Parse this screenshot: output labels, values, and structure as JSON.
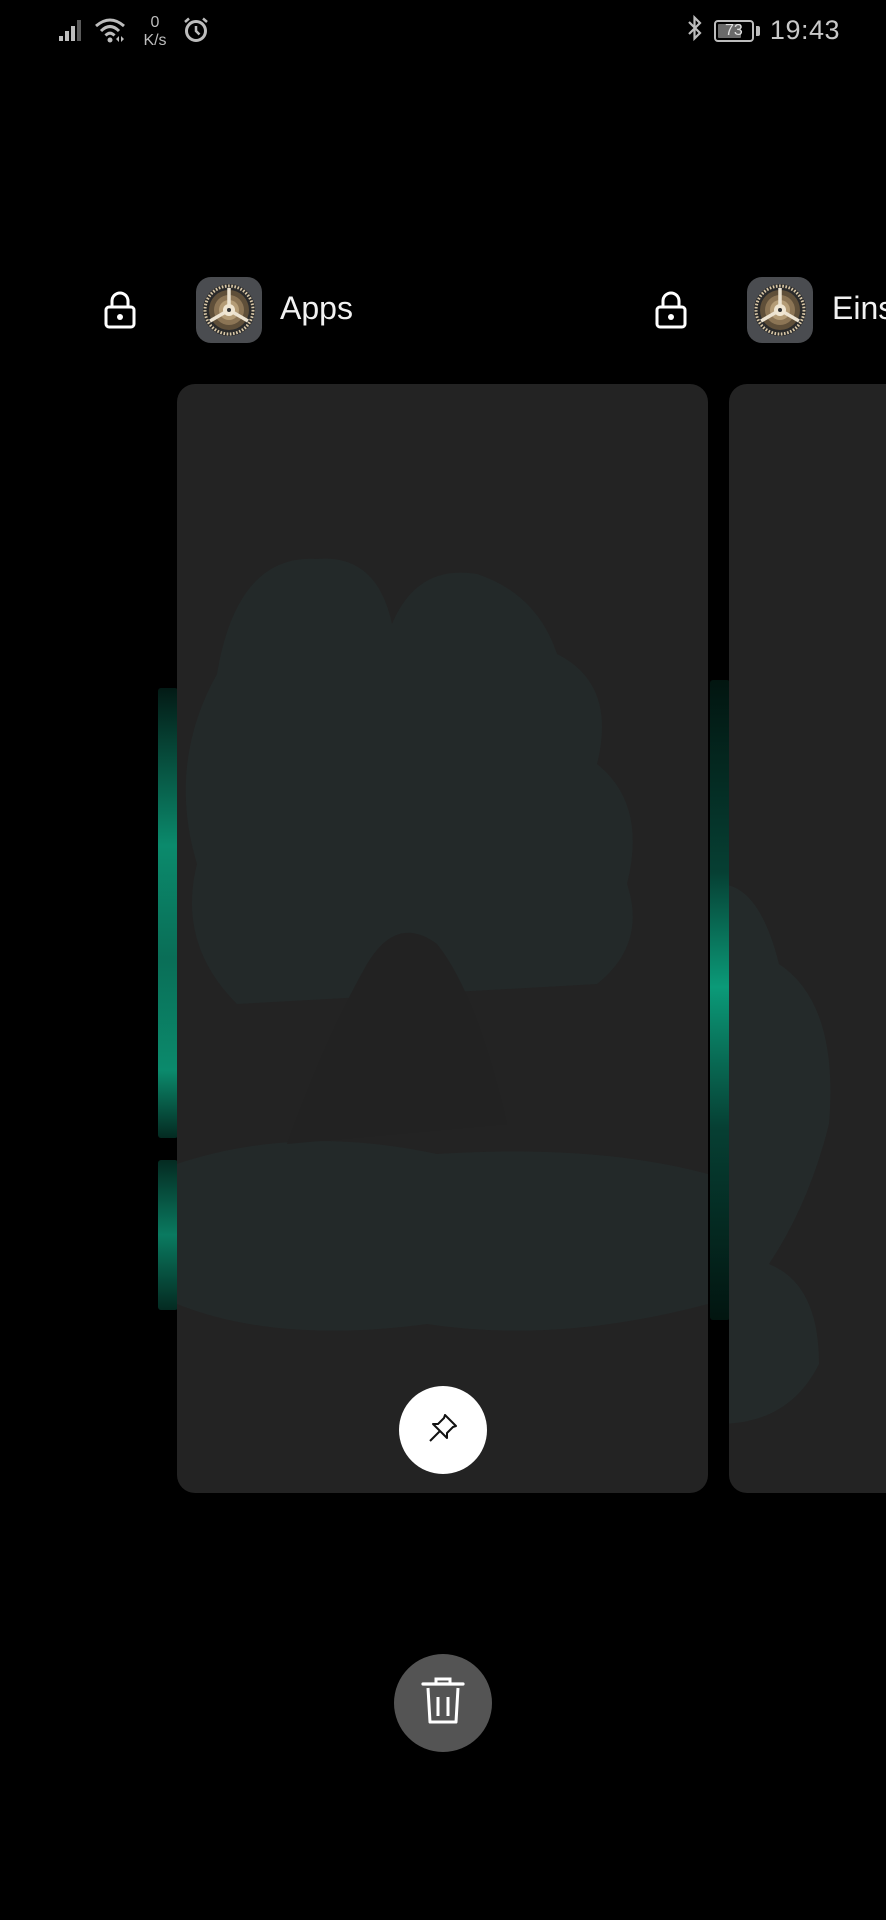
{
  "status_bar": {
    "net_speed_value": "0",
    "net_speed_unit": "K/s",
    "battery_level": "73",
    "battery_fraction": 0.73,
    "time": "19:43",
    "icons": [
      "signal-icon",
      "wifi-icon",
      "alarm-icon",
      "bluetooth-icon",
      "battery-icon"
    ]
  },
  "recents": {
    "cards": [
      {
        "title": "Apps",
        "icon": "settings-gear-icon",
        "locked_icon": "lock-icon"
      },
      {
        "title": "Eins",
        "icon": "settings-gear-icon",
        "locked_icon": "lock-icon"
      }
    ],
    "pin_button": {
      "icon": "pin-icon"
    },
    "clear_all_button": {
      "icon": "trash-icon"
    }
  },
  "colors": {
    "background": "#000000",
    "card": "#232323",
    "accent_teal": "#0b8a6c",
    "clear_button": "#545454",
    "pin_button": "#ffffff"
  }
}
